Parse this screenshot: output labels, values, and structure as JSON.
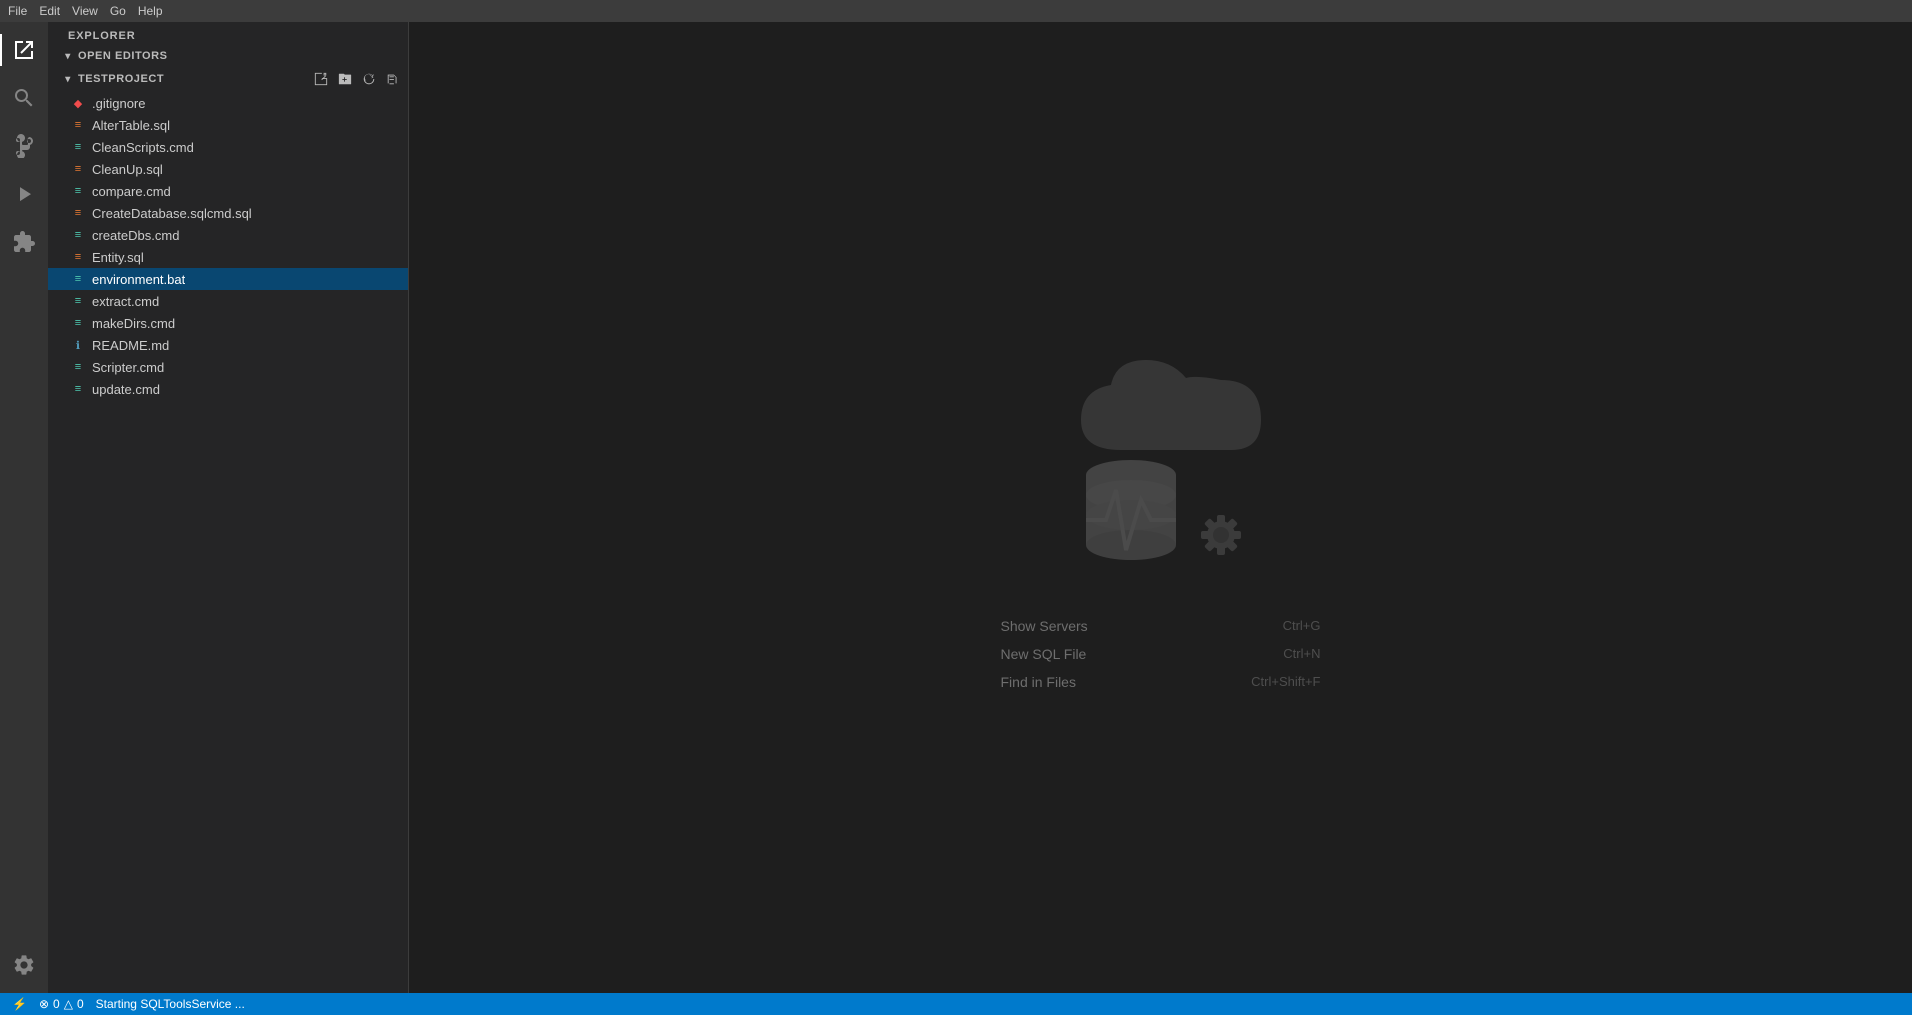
{
  "titlebar": {
    "menus": [
      "File",
      "Edit",
      "View",
      "Go",
      "Help"
    ]
  },
  "activitybar": {
    "icons": [
      {
        "name": "explorer-icon",
        "label": "Explorer",
        "active": true,
        "symbol": "📁"
      },
      {
        "name": "search-icon",
        "label": "Search",
        "active": false,
        "symbol": "🔍"
      },
      {
        "name": "source-control-icon",
        "label": "Source Control",
        "active": false,
        "symbol": "⎇"
      },
      {
        "name": "debug-icon",
        "label": "Run and Debug",
        "active": false,
        "symbol": "▷"
      },
      {
        "name": "extensions-icon",
        "label": "Extensions",
        "active": false,
        "symbol": "⧉"
      }
    ],
    "bottom_icons": [
      {
        "name": "settings-icon",
        "label": "Settings",
        "symbol": "⚙"
      }
    ]
  },
  "sidebar": {
    "title": "EXPLORER",
    "sections": [
      {
        "name": "open-editors",
        "label": "OPEN EDITORS",
        "expanded": true,
        "files": []
      },
      {
        "name": "testproject",
        "label": "TESTPROJECT",
        "expanded": true,
        "toolbar_buttons": [
          {
            "name": "new-file-btn",
            "symbol": "⊞",
            "title": "New File"
          },
          {
            "name": "new-folder-btn",
            "symbol": "⊟",
            "title": "New Folder"
          },
          {
            "name": "refresh-btn",
            "symbol": "↺",
            "title": "Refresh"
          },
          {
            "name": "collapse-btn",
            "symbol": "⊡",
            "title": "Collapse All"
          }
        ],
        "files": [
          {
            "name": ".gitignore",
            "icon_type": "gitignore",
            "icon_char": "◆",
            "selected": false
          },
          {
            "name": "AlterTable.sql",
            "icon_type": "sql",
            "icon_char": "≡",
            "selected": false
          },
          {
            "name": "CleanScripts.cmd",
            "icon_type": "cmd",
            "icon_char": "≡",
            "selected": false
          },
          {
            "name": "CleanUp.sql",
            "icon_type": "sql",
            "icon_char": "≡",
            "selected": false
          },
          {
            "name": "compare.cmd",
            "icon_type": "cmd",
            "icon_char": "≡",
            "selected": false
          },
          {
            "name": "CreateDatabase.sqlcmd.sql",
            "icon_type": "sql",
            "icon_char": "≡",
            "selected": false
          },
          {
            "name": "createDbs.cmd",
            "icon_type": "cmd",
            "icon_char": "≡",
            "selected": false
          },
          {
            "name": "Entity.sql",
            "icon_type": "sql",
            "icon_char": "≡",
            "selected": false
          },
          {
            "name": "environment.bat",
            "icon_type": "bat",
            "icon_char": "≡",
            "selected": true
          },
          {
            "name": "extract.cmd",
            "icon_type": "cmd",
            "icon_char": "≡",
            "selected": false
          },
          {
            "name": "makeDirs.cmd",
            "icon_type": "cmd",
            "icon_char": "≡",
            "selected": false
          },
          {
            "name": "README.md",
            "icon_type": "md",
            "icon_char": "ℹ",
            "selected": false
          },
          {
            "name": "Scripter.cmd",
            "icon_type": "cmd",
            "icon_char": "≡",
            "selected": false
          },
          {
            "name": "update.cmd",
            "icon_type": "cmd",
            "icon_char": "≡",
            "selected": false
          }
        ]
      }
    ]
  },
  "editor": {
    "welcome": {
      "actions": [
        {
          "name": "show-servers",
          "label": "Show Servers",
          "shortcut": "Ctrl+G"
        },
        {
          "name": "new-sql-file",
          "label": "New SQL File",
          "shortcut": "Ctrl+N"
        },
        {
          "name": "find-in-files",
          "label": "Find in Files",
          "shortcut": "Ctrl+Shift+F"
        }
      ]
    }
  },
  "statusbar": {
    "left_items": [
      {
        "name": "remote-icon",
        "text": "⚡",
        "label": "Remote"
      },
      {
        "name": "errors",
        "text": "⊗ 0",
        "label": "Errors"
      },
      {
        "name": "warnings",
        "text": "△ 0",
        "label": "Warnings"
      },
      {
        "name": "status-text",
        "text": "Starting SQLToolsService ...",
        "label": "Status"
      }
    ]
  }
}
